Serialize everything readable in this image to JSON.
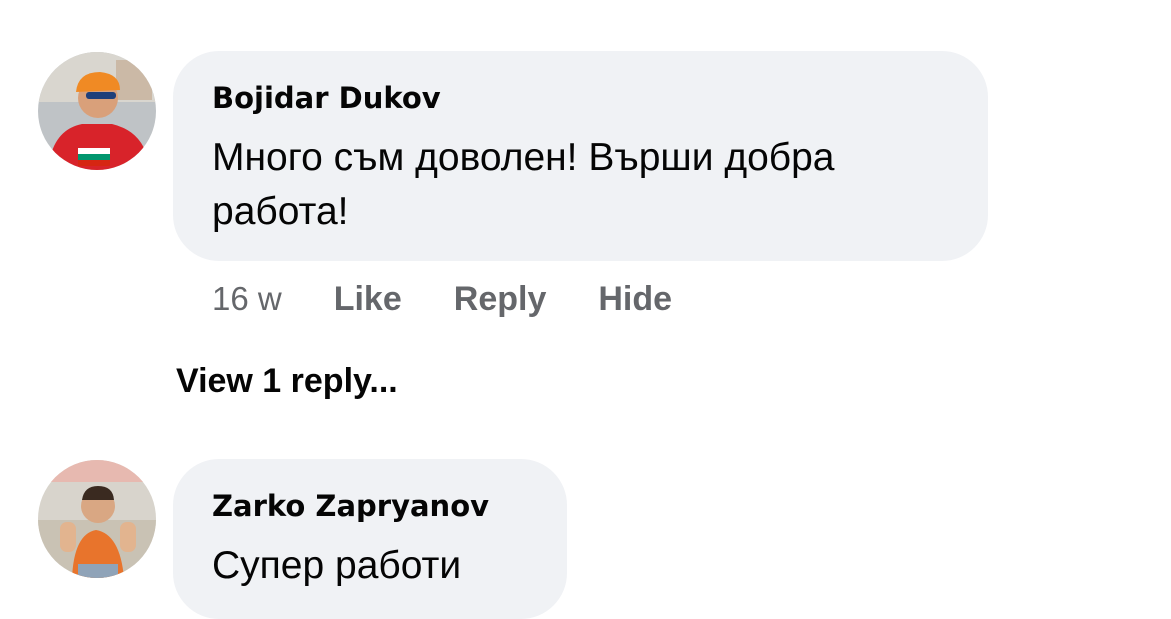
{
  "comments": [
    {
      "author": "Bojidar Dukov",
      "text": "Много съм доволен! Върши добра работа!",
      "time": "16 w",
      "actions": {
        "like": "Like",
        "reply": "Reply",
        "hide": "Hide"
      },
      "view_replies": "View 1 reply..."
    },
    {
      "author": "Zarko Zapryanov",
      "text": "Супер работи"
    }
  ],
  "icons": {
    "avatar_1": "avatar-photo-icon",
    "avatar_2": "avatar-photo-icon"
  },
  "colors": {
    "bubble": "#f0f2f5",
    "meta_text": "#65676b",
    "primary_text": "#050505"
  }
}
